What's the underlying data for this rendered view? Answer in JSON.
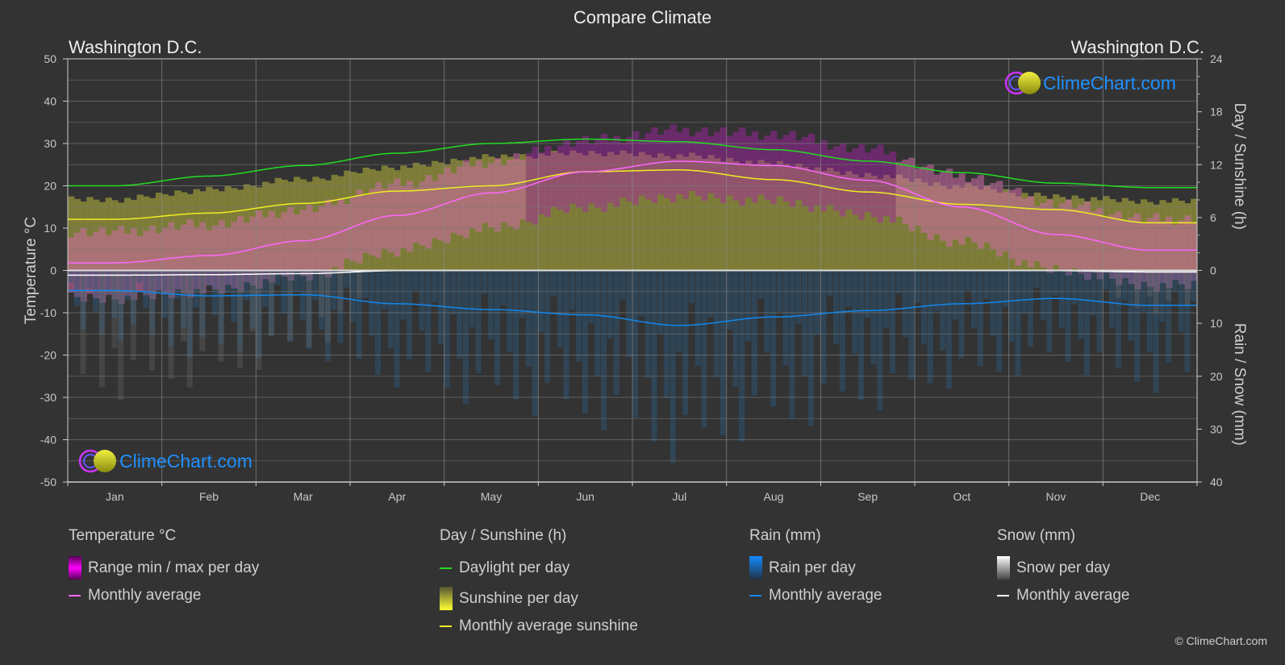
{
  "header": {
    "title": "Compare Climate",
    "city_left": "Washington D.C.",
    "city_right": "Washington D.C."
  },
  "watermark": {
    "text": "ClimeChart.com"
  },
  "copyright": "© ClimeChart.com",
  "legend": {
    "groups": [
      {
        "title": "Temperature °C",
        "items": [
          {
            "label": "Range min / max per day",
            "kind": "box",
            "color": "#e600e6"
          },
          {
            "label": "Monthly average",
            "kind": "line",
            "color": "#ff66ff"
          }
        ]
      },
      {
        "title": "Day / Sunshine (h)",
        "items": [
          {
            "label": "Daylight per day",
            "kind": "line",
            "color": "#22dd22"
          },
          {
            "label": "Sunshine per day",
            "kind": "box",
            "color": "#eeee33"
          },
          {
            "label": "Monthly average sunshine",
            "kind": "line",
            "color": "#eeee22"
          }
        ]
      },
      {
        "title": "Rain (mm)",
        "items": [
          {
            "label": "Rain per day",
            "kind": "box",
            "color": "#1188ee"
          },
          {
            "label": "Monthly average",
            "kind": "line",
            "color": "#1188ee"
          }
        ]
      },
      {
        "title": "Snow (mm)",
        "items": [
          {
            "label": "Snow per day",
            "kind": "box",
            "color": "#dddddd"
          },
          {
            "label": "Monthly average",
            "kind": "line",
            "color": "#ffffff"
          }
        ]
      }
    ]
  },
  "chart_data": {
    "type": "line",
    "title": "Compare Climate",
    "categories": [
      "Jan",
      "Feb",
      "Mar",
      "Apr",
      "May",
      "Jun",
      "Jul",
      "Aug",
      "Sep",
      "Oct",
      "Nov",
      "Dec"
    ],
    "y_left": {
      "label": "Temperature °C",
      "range": [
        -50,
        50
      ],
      "ticks": [
        50,
        40,
        30,
        20,
        10,
        0,
        -10,
        -20,
        -30,
        -40,
        -50
      ]
    },
    "y_right_top": {
      "label": "Day / Sunshine (h)",
      "range": [
        0,
        24
      ],
      "ticks": [
        24,
        18,
        12,
        6,
        0
      ]
    },
    "y_right_bottom": {
      "label": "Rain / Snow (mm)",
      "range": [
        0,
        40
      ],
      "ticks": [
        0,
        10,
        20,
        30,
        40
      ]
    },
    "grid": true,
    "series": [
      {
        "name": "Daylight per day",
        "unit": "h",
        "color": "#22dd22",
        "values": [
          9.6,
          10.7,
          11.9,
          13.3,
          14.4,
          14.9,
          14.6,
          13.7,
          12.4,
          11.1,
          9.9,
          9.4
        ]
      },
      {
        "name": "Monthly average sunshine",
        "unit": "h",
        "color": "#eeee22",
        "values": [
          5.8,
          6.5,
          7.6,
          9.0,
          9.6,
          11.2,
          11.4,
          10.3,
          8.9,
          7.5,
          6.9,
          5.4
        ]
      },
      {
        "name": "Temperature monthly average",
        "unit": "°C",
        "color": "#ff66ff",
        "values": [
          1.8,
          3.5,
          7.0,
          13.0,
          18.3,
          23.3,
          25.8,
          24.8,
          21.3,
          15.0,
          8.5,
          4.8
        ]
      },
      {
        "name": "Rain monthly average",
        "unit": "mm",
        "color": "#1188ee",
        "values": [
          3.8,
          4.8,
          4.6,
          6.3,
          7.4,
          8.4,
          10.4,
          8.8,
          7.6,
          6.3,
          5.3,
          6.6
        ]
      },
      {
        "name": "Snow monthly average",
        "unit": "mm",
        "color": "#ffffff",
        "values": [
          0.9,
          0.8,
          0.6,
          0.05,
          0,
          0,
          0,
          0,
          0,
          0,
          0.05,
          0.3
        ]
      }
    ],
    "legend_position": "bottom"
  }
}
